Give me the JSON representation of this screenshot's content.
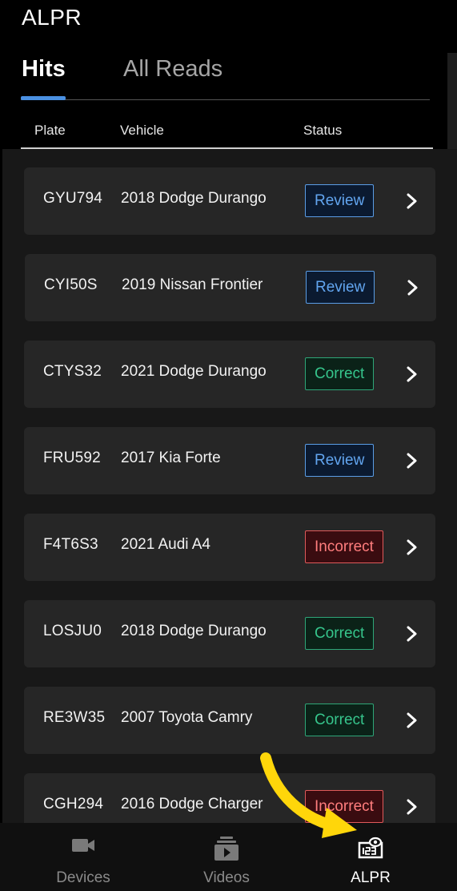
{
  "app": {
    "title": "ALPR"
  },
  "tabs": [
    {
      "label": "Hits",
      "active": true
    },
    {
      "label": "All Reads",
      "active": false
    }
  ],
  "columns": {
    "plate": "Plate",
    "vehicle": "Vehicle",
    "status": "Status"
  },
  "rows": [
    {
      "plate": "GYU794",
      "vehicle": "2018 Dodge Durango",
      "status": "Review"
    },
    {
      "plate": "CYI50S",
      "vehicle": "2019 Nissan Frontier",
      "status": "Review"
    },
    {
      "plate": "CTYS32",
      "vehicle": "2021 Dodge Durango",
      "status": "Correct"
    },
    {
      "plate": "FRU592",
      "vehicle": "2017 Kia Forte",
      "status": "Review"
    },
    {
      "plate": "F4T6S3",
      "vehicle": "2021 Audi A4",
      "status": "Incorrect"
    },
    {
      "plate": "LOSJU0",
      "vehicle": "2018 Dodge Durango",
      "status": "Correct"
    },
    {
      "plate": "RE3W35",
      "vehicle": "2007 Toyota Camry",
      "status": "Correct"
    },
    {
      "plate": "CGH294",
      "vehicle": "2016 Dodge Charger",
      "status": "Incorrect"
    }
  ],
  "nav": {
    "devices": {
      "label": "Devices",
      "icon": "video-camera-icon"
    },
    "videos": {
      "label": "Videos",
      "icon": "video-library-icon"
    },
    "alpr": {
      "label": "ALPR",
      "icon": "license-plate-icon",
      "active": true
    }
  },
  "colors": {
    "accent": "#4a90e2",
    "review": "#62a5ef",
    "correct": "#36c58c",
    "incorrect": "#ff7d7d",
    "annotation": "#ffd60a"
  }
}
